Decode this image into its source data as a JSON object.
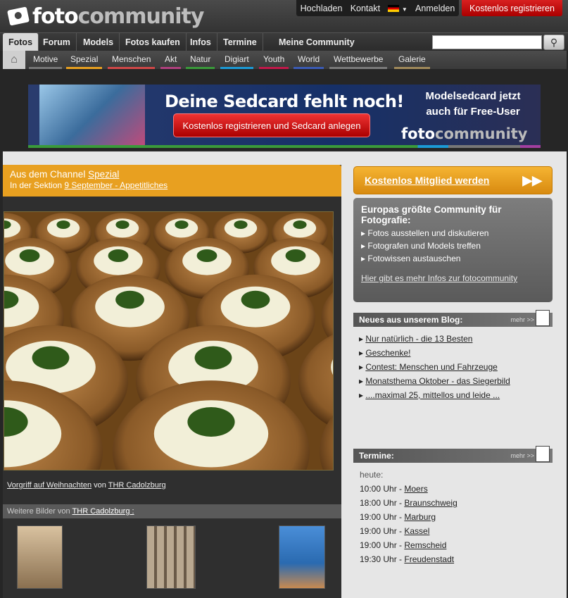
{
  "header": {
    "logo_main": "foto",
    "logo_bold": "community",
    "utility": [
      "Hochladen",
      "Kontakt",
      "Anmelden"
    ],
    "language_flag": "de-flag-icon",
    "register_label": "Kostenlos registrieren"
  },
  "nav": {
    "items": [
      "Fotos",
      "Forum",
      "Models",
      "Fotos kaufen",
      "Infos",
      "Termine",
      "Meine Community"
    ],
    "search_placeholder": "",
    "search_icon": "search-icon"
  },
  "subnav": {
    "home_icon": "home-icon",
    "items": [
      {
        "label": "Motive",
        "color": "#777777"
      },
      {
        "label": "Spezial",
        "color": "#e8a020"
      },
      {
        "label": "Menschen",
        "color": "#d04848"
      },
      {
        "label": "Akt",
        "color": "#b0407e"
      },
      {
        "label": "Natur",
        "color": "#3a9a3a"
      },
      {
        "label": "Digiart",
        "color": "#1b9ad6"
      },
      {
        "label": "Youth",
        "color": "#c2184a"
      },
      {
        "label": "World",
        "color": "#3b5bb5"
      },
      {
        "label": "Wettbewerbe",
        "color": "#7a7a7a"
      },
      {
        "label": "Galerie",
        "color": "#a08a5a"
      }
    ]
  },
  "banner": {
    "headline": "Deine Sedcard fehlt noch!",
    "cta": "Kostenlos registrieren und Sedcard anlegen",
    "side_line1": "Modelsedcard jetzt",
    "side_line2": "auch für Free-User",
    "logo_main": "foto",
    "logo_bold": "community"
  },
  "channel": {
    "prefix": "Aus dem Channel",
    "channel_name": "Spezial",
    "section_prefix": "In der Sektion",
    "section_name": "9 September - Appetitliches"
  },
  "photo": {
    "title": "Vorgriff auf Weihnachten",
    "by": "von",
    "author": "THR Cadolzburg"
  },
  "more_images": {
    "prefix": "Weitere Bilder von",
    "author": "THR Cadolzburg :"
  },
  "sidebar": {
    "cta_label": "Kostenlos Mitglied werden",
    "cta_icon": "double-arrow-icon",
    "info_title": "Europas größte Community für Fotografie:",
    "info_items": [
      "Fotos ausstellen und diskutieren",
      "Fotografen und Models treffen",
      "Fotowissen austauschen"
    ],
    "info_link": "Hier gibt es mehr Infos zur fotocommunity",
    "blog_title": "Neues aus unserem Blog:",
    "mehr": "mehr >>",
    "blog_items": [
      "Nur natürlich - die 13 Besten",
      "Geschenke!",
      "Contest: Menschen und Fahrzeuge",
      "Monatsthema Oktober - das Siegerbild",
      "....maximal 25, mittellos und leide ..."
    ],
    "termine_title": "Termine:",
    "termine_today": "heute:",
    "termine": [
      {
        "time": "10:00 Uhr -",
        "city": "Moers"
      },
      {
        "time": "18:00 Uhr -",
        "city": "Braunschweig"
      },
      {
        "time": "19:00 Uhr -",
        "city": "Marburg"
      },
      {
        "time": "19:00 Uhr -",
        "city": "Kassel"
      },
      {
        "time": "19:00 Uhr -",
        "city": "Remscheid"
      },
      {
        "time": "19:30 Uhr -",
        "city": "Freudenstadt"
      }
    ]
  }
}
